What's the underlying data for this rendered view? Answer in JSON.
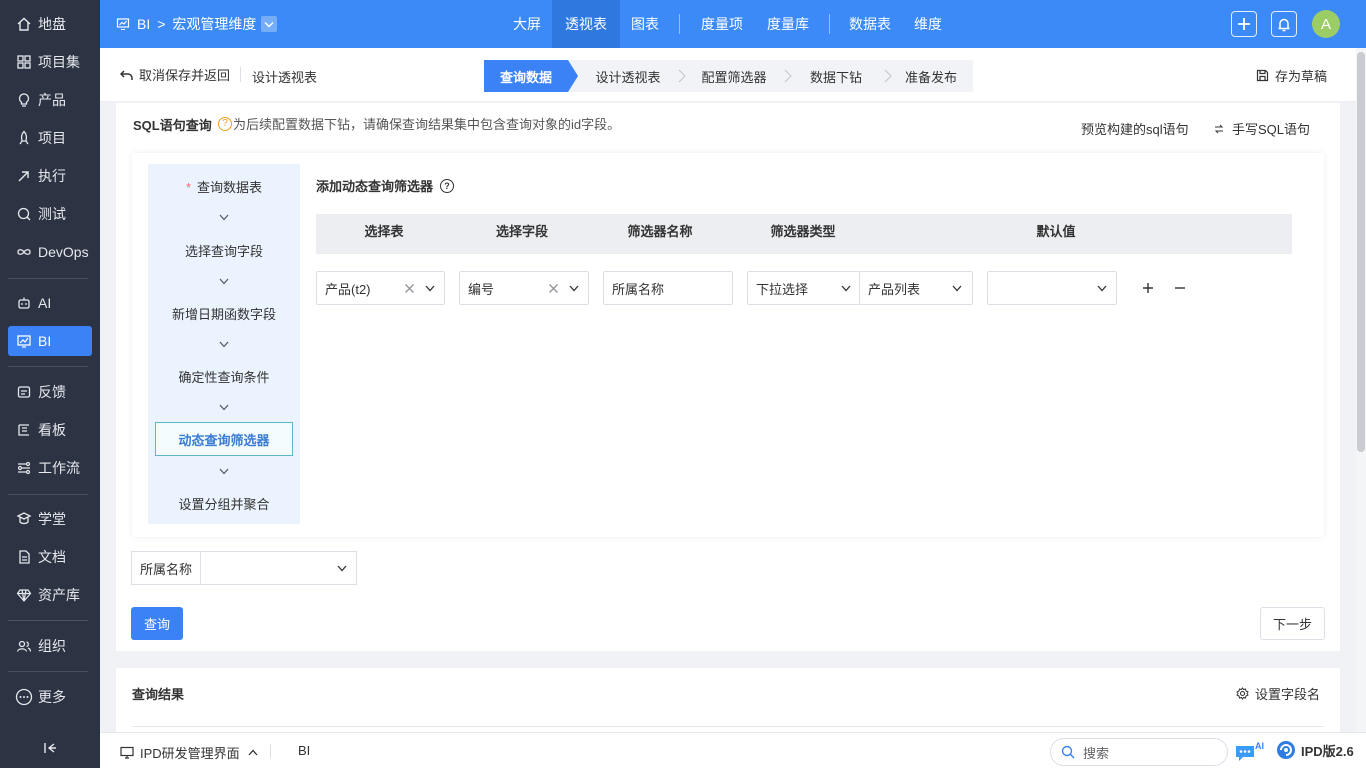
{
  "sidebar": {
    "items": [
      {
        "label": "地盘",
        "icon": "home-icon"
      },
      {
        "label": "项目集",
        "icon": "grid-icon"
      },
      {
        "label": "产品",
        "icon": "bulb-icon"
      },
      {
        "label": "项目",
        "icon": "rocket-icon"
      },
      {
        "label": "执行",
        "icon": "run-icon"
      },
      {
        "label": "测试",
        "icon": "test-icon"
      },
      {
        "label": "DevOps",
        "icon": "infinity-icon"
      },
      {
        "label": "AI",
        "icon": "robot-icon"
      },
      {
        "label": "BI",
        "icon": "chart-board-icon"
      },
      {
        "label": "反馈",
        "icon": "feedback-icon"
      },
      {
        "label": "看板",
        "icon": "kanban-icon"
      },
      {
        "label": "工作流",
        "icon": "workflow-icon"
      },
      {
        "label": "学堂",
        "icon": "school-icon"
      },
      {
        "label": "文档",
        "icon": "doc-icon"
      },
      {
        "label": "资产库",
        "icon": "diamond-icon"
      },
      {
        "label": "组织",
        "icon": "people-icon"
      },
      {
        "label": "更多",
        "icon": "more-icon"
      }
    ],
    "active": "BI"
  },
  "topbar": {
    "crumb_root": "BI",
    "crumb_current": "宏观管理维度",
    "nav": [
      "大屏",
      "透视表",
      "图表",
      "度量项",
      "度量库",
      "数据表",
      "维度"
    ],
    "active_nav": "透视表",
    "avatar_letter": "A"
  },
  "subhead": {
    "cancel_back": "取消保存并返回",
    "title": "设计透视表",
    "steps": [
      "查询数据",
      "设计透视表",
      "配置筛选器",
      "数据下钻",
      "准备发布"
    ],
    "active_step": "查询数据",
    "save_draft": "存为草稿"
  },
  "sql": {
    "title": "SQL语句查询",
    "hint": "为后续配置数据下钻，请确保查询结果集中包含查询对象的id字段。",
    "preview": "预览构建的sql语句",
    "handwrite": "手写SQL语句"
  },
  "builder": {
    "steps": [
      "查询数据表",
      "选择查询字段",
      "新增日期函数字段",
      "确定性查询条件",
      "动态查询筛选器",
      "设置分组并聚合"
    ],
    "active_step": "动态查询筛选器",
    "dyn_title": "添加动态查询筛选器",
    "headers": [
      "选择表",
      "选择字段",
      "筛选器名称",
      "筛选器类型",
      "默认值"
    ],
    "row": {
      "table": "产品(t2)",
      "field": "编号",
      "name": "所属名称",
      "type": "下拉选择",
      "type_source": "产品列表",
      "default": ""
    }
  },
  "filter": {
    "label": "所属名称",
    "value": ""
  },
  "buttons": {
    "query": "查询",
    "next": "下一步"
  },
  "results": {
    "title": "查询结果",
    "set_field": "设置字段名"
  },
  "footer": {
    "app": "IPD研发管理界面",
    "module": "BI",
    "search_placeholder": "搜索",
    "version": "IPD版2.6"
  },
  "colors": {
    "primary": "#3b82f6",
    "topbar": "#3b8af7",
    "sidebar": "#2c3444"
  }
}
